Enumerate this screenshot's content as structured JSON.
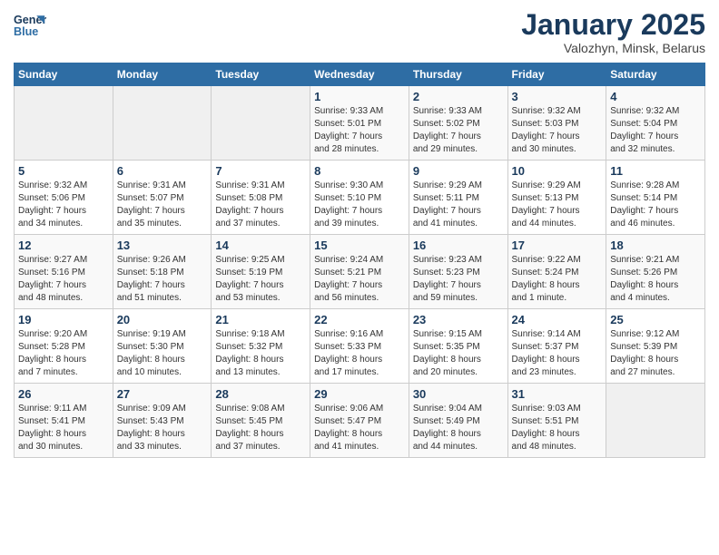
{
  "logo": {
    "line1": "General",
    "line2": "Blue"
  },
  "title": "January 2025",
  "subtitle": "Valozhyn, Minsk, Belarus",
  "weekdays": [
    "Sunday",
    "Monday",
    "Tuesday",
    "Wednesday",
    "Thursday",
    "Friday",
    "Saturday"
  ],
  "weeks": [
    [
      {
        "day": "",
        "info": ""
      },
      {
        "day": "",
        "info": ""
      },
      {
        "day": "",
        "info": ""
      },
      {
        "day": "1",
        "info": "Sunrise: 9:33 AM\nSunset: 5:01 PM\nDaylight: 7 hours\nand 28 minutes."
      },
      {
        "day": "2",
        "info": "Sunrise: 9:33 AM\nSunset: 5:02 PM\nDaylight: 7 hours\nand 29 minutes."
      },
      {
        "day": "3",
        "info": "Sunrise: 9:32 AM\nSunset: 5:03 PM\nDaylight: 7 hours\nand 30 minutes."
      },
      {
        "day": "4",
        "info": "Sunrise: 9:32 AM\nSunset: 5:04 PM\nDaylight: 7 hours\nand 32 minutes."
      }
    ],
    [
      {
        "day": "5",
        "info": "Sunrise: 9:32 AM\nSunset: 5:06 PM\nDaylight: 7 hours\nand 34 minutes."
      },
      {
        "day": "6",
        "info": "Sunrise: 9:31 AM\nSunset: 5:07 PM\nDaylight: 7 hours\nand 35 minutes."
      },
      {
        "day": "7",
        "info": "Sunrise: 9:31 AM\nSunset: 5:08 PM\nDaylight: 7 hours\nand 37 minutes."
      },
      {
        "day": "8",
        "info": "Sunrise: 9:30 AM\nSunset: 5:10 PM\nDaylight: 7 hours\nand 39 minutes."
      },
      {
        "day": "9",
        "info": "Sunrise: 9:29 AM\nSunset: 5:11 PM\nDaylight: 7 hours\nand 41 minutes."
      },
      {
        "day": "10",
        "info": "Sunrise: 9:29 AM\nSunset: 5:13 PM\nDaylight: 7 hours\nand 44 minutes."
      },
      {
        "day": "11",
        "info": "Sunrise: 9:28 AM\nSunset: 5:14 PM\nDaylight: 7 hours\nand 46 minutes."
      }
    ],
    [
      {
        "day": "12",
        "info": "Sunrise: 9:27 AM\nSunset: 5:16 PM\nDaylight: 7 hours\nand 48 minutes."
      },
      {
        "day": "13",
        "info": "Sunrise: 9:26 AM\nSunset: 5:18 PM\nDaylight: 7 hours\nand 51 minutes."
      },
      {
        "day": "14",
        "info": "Sunrise: 9:25 AM\nSunset: 5:19 PM\nDaylight: 7 hours\nand 53 minutes."
      },
      {
        "day": "15",
        "info": "Sunrise: 9:24 AM\nSunset: 5:21 PM\nDaylight: 7 hours\nand 56 minutes."
      },
      {
        "day": "16",
        "info": "Sunrise: 9:23 AM\nSunset: 5:23 PM\nDaylight: 7 hours\nand 59 minutes."
      },
      {
        "day": "17",
        "info": "Sunrise: 9:22 AM\nSunset: 5:24 PM\nDaylight: 8 hours\nand 1 minute."
      },
      {
        "day": "18",
        "info": "Sunrise: 9:21 AM\nSunset: 5:26 PM\nDaylight: 8 hours\nand 4 minutes."
      }
    ],
    [
      {
        "day": "19",
        "info": "Sunrise: 9:20 AM\nSunset: 5:28 PM\nDaylight: 8 hours\nand 7 minutes."
      },
      {
        "day": "20",
        "info": "Sunrise: 9:19 AM\nSunset: 5:30 PM\nDaylight: 8 hours\nand 10 minutes."
      },
      {
        "day": "21",
        "info": "Sunrise: 9:18 AM\nSunset: 5:32 PM\nDaylight: 8 hours\nand 13 minutes."
      },
      {
        "day": "22",
        "info": "Sunrise: 9:16 AM\nSunset: 5:33 PM\nDaylight: 8 hours\nand 17 minutes."
      },
      {
        "day": "23",
        "info": "Sunrise: 9:15 AM\nSunset: 5:35 PM\nDaylight: 8 hours\nand 20 minutes."
      },
      {
        "day": "24",
        "info": "Sunrise: 9:14 AM\nSunset: 5:37 PM\nDaylight: 8 hours\nand 23 minutes."
      },
      {
        "day": "25",
        "info": "Sunrise: 9:12 AM\nSunset: 5:39 PM\nDaylight: 8 hours\nand 27 minutes."
      }
    ],
    [
      {
        "day": "26",
        "info": "Sunrise: 9:11 AM\nSunset: 5:41 PM\nDaylight: 8 hours\nand 30 minutes."
      },
      {
        "day": "27",
        "info": "Sunrise: 9:09 AM\nSunset: 5:43 PM\nDaylight: 8 hours\nand 33 minutes."
      },
      {
        "day": "28",
        "info": "Sunrise: 9:08 AM\nSunset: 5:45 PM\nDaylight: 8 hours\nand 37 minutes."
      },
      {
        "day": "29",
        "info": "Sunrise: 9:06 AM\nSunset: 5:47 PM\nDaylight: 8 hours\nand 41 minutes."
      },
      {
        "day": "30",
        "info": "Sunrise: 9:04 AM\nSunset: 5:49 PM\nDaylight: 8 hours\nand 44 minutes."
      },
      {
        "day": "31",
        "info": "Sunrise: 9:03 AM\nSunset: 5:51 PM\nDaylight: 8 hours\nand 48 minutes."
      },
      {
        "day": "",
        "info": ""
      }
    ]
  ]
}
